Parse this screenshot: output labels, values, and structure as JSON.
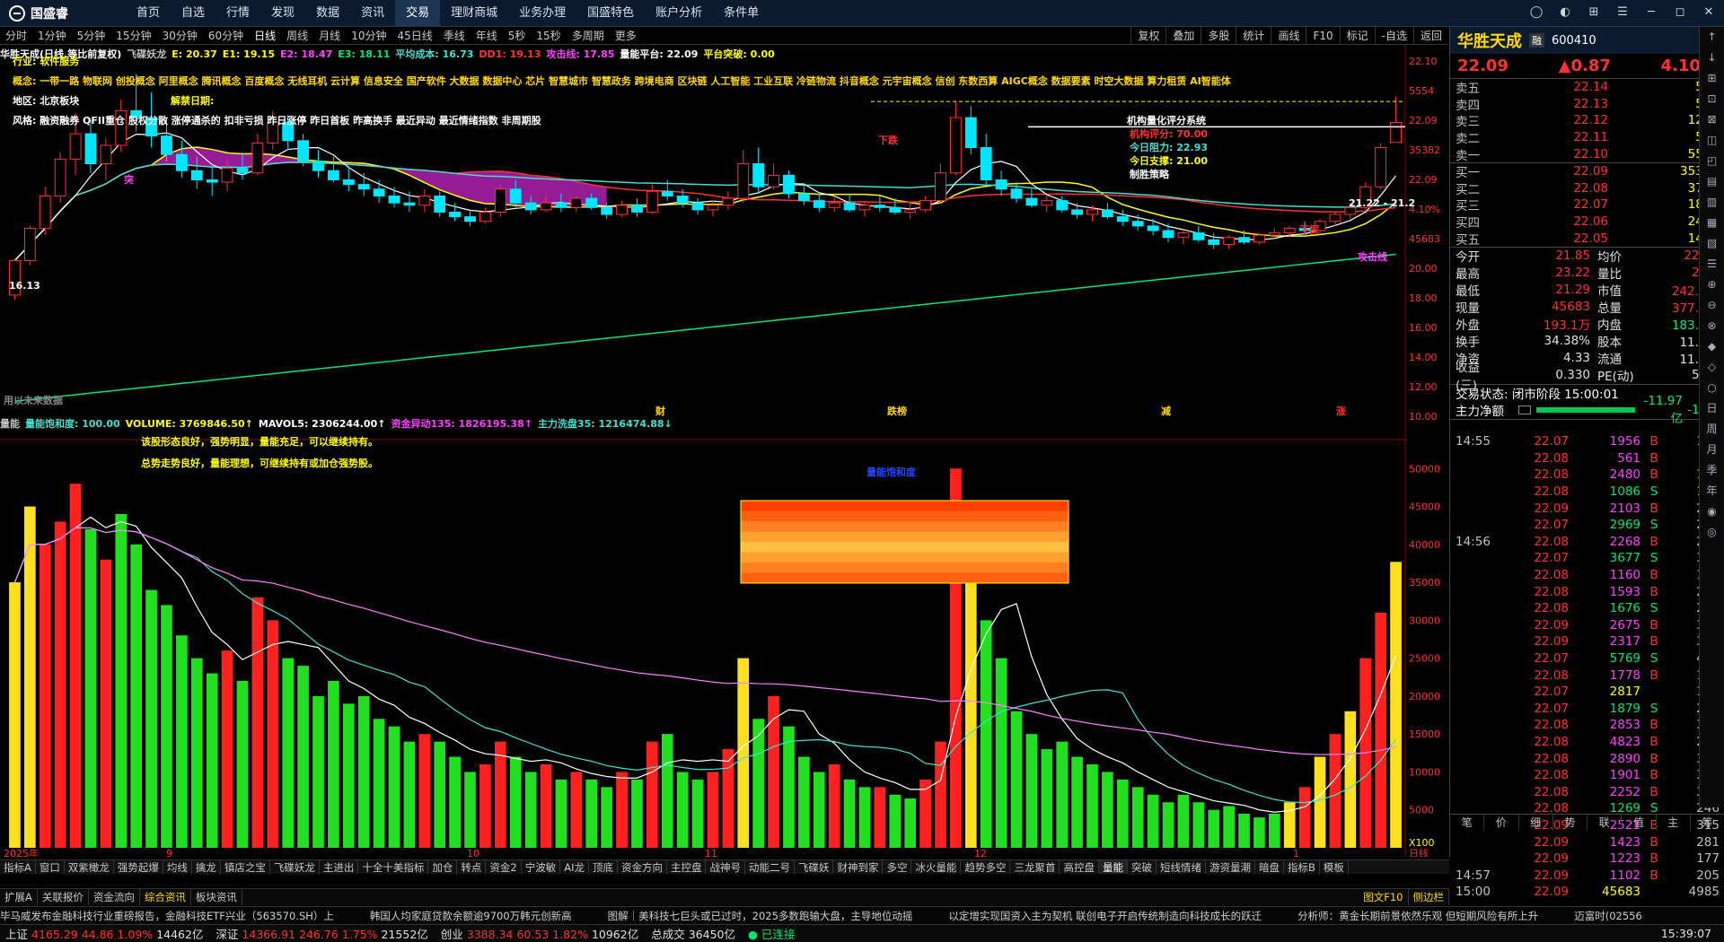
{
  "app": {
    "logo": "国盛睿"
  },
  "menu": [
    "首页",
    "自选",
    "行情",
    "发现",
    "数据",
    "资讯",
    "交易",
    "理财商城",
    "业务办理",
    "国盛特色",
    "账户分析",
    "条件单"
  ],
  "menu_active": 6,
  "periods": [
    "分时",
    "1分钟",
    "5分钟",
    "15分钟",
    "30分钟",
    "60分钟",
    "日线",
    "周线",
    "月线",
    "10分钟",
    "45日线",
    "季线",
    "年线",
    "5秒",
    "15秒",
    "多周期",
    "更多"
  ],
  "period_active": 6,
  "period_right": [
    "复权",
    "叠加",
    "多股",
    "统计",
    "画线",
    "F10",
    "标记",
    "-自选",
    "返回"
  ],
  "kline": {
    "title": "华胜天成(日线,等比前复权)",
    "legend": [
      {
        "t": "飞碟妖龙",
        "c": "#c0c0c0"
      },
      {
        "t": "E: 20.37",
        "c": "#ffff00"
      },
      {
        "t": "E1: 19.15",
        "c": "#ffff00"
      },
      {
        "t": "E2: 18.47",
        "c": "#ff40ff"
      },
      {
        "t": "E3: 18.11",
        "c": "#00e676"
      },
      {
        "t": "平均成本: 16.73",
        "c": "#40e0d0"
      },
      {
        "t": "DD1: 19.13",
        "c": "#ff3030"
      },
      {
        "t": "攻击线: 17.85",
        "c": "#ff40ff"
      },
      {
        "t": "量能平台: 22.09",
        "c": "#ffffff"
      },
      {
        "t": "平台突破: 0.00",
        "c": "#ffff00"
      }
    ],
    "industry": "行业: 软件服务",
    "concept": "概念: 一带一路 物联网 创投概念 阿里概念 腾讯概念 百度概念 无线耳机 云计算 信息安全 国产软件 大数据 数据中心 芯片 智慧城市 智慧政务 跨境电商 区块链 人工智能 工业互联 冷链物流 抖音概念 元宇宙概念 信创 东数西算 AIGC概念 数据要素 时空大数据 算力租赁 AI智能体",
    "region": "地区: 北京板块",
    "unlock": "解禁日期:",
    "style": "风格: 融资融券 QFII重仓 股权分散 涨停通杀的 扣非亏损 昨日涨停 昨日首板 昨高换手 最近异动 最近情绪指数 非周期股",
    "score_title": "机构量化评分系统",
    "score_lines": [
      "机构评分: 70.00",
      "今日阻力: 22.93",
      "今日支撑: 21.00",
      "制胜策略"
    ],
    "labels": {
      "xiadie": "下跌",
      "tuqi": "突",
      "dayuechu": "大阴戳",
      "xiaojiao": "下探",
      "gongji": "攻击线",
      "val1": "16.13",
      "val2": "21.22 - 21.2",
      "cai": "财",
      "dieting": "跌榜",
      "jian": "减",
      "zhang": "涨",
      "weilai": "用以未来数据"
    },
    "yaxis": [
      "22.10",
      "5554",
      "22.09",
      "35382",
      "22.09",
      "4.10%",
      "45683",
      "20.00",
      "18.00",
      "16.00",
      "14.00",
      "12.00",
      "10.00"
    ]
  },
  "volume": {
    "legend": [
      {
        "t": "量能",
        "c": "#c0c0c0"
      },
      {
        "t": "量能饱和度: 100.00",
        "c": "#40e0d0"
      },
      {
        "t": "VOLUME: 3769846.50↑",
        "c": "#ffff00"
      },
      {
        "t": "MAVOL5: 2306244.00↑",
        "c": "#ffffff"
      },
      {
        "t": "资金异动135: 1826195.38↑",
        "c": "#ff40ff"
      },
      {
        "t": "主力洗盘35: 1216474.88↓",
        "c": "#40e0d0"
      }
    ],
    "comments": [
      "该股形态良好，强势明显，量能充足，可以继续持有。",
      "总势走势良好，量能理想，可继续持有或加仓强势股。"
    ],
    "box_label": "量能饱和度",
    "yaxis": [
      "50000",
      "45000",
      "40000",
      "35000",
      "30000",
      "25000",
      "20000",
      "15000",
      "10000",
      "5000"
    ],
    "unit": "X100"
  },
  "dates": [
    "2025年",
    "9",
    "10",
    "11",
    "12",
    "1",
    "日线"
  ],
  "indicators": [
    "指标A",
    "窗口",
    "双紫橄龙",
    "强势起爆",
    "均线",
    "擒龙",
    "镇店之宝",
    "飞碟妖龙",
    "主进出",
    "十全十美指标",
    "加仓",
    "转点",
    "资金2",
    "宁波敏",
    "AI龙",
    "顶底",
    "资金方向",
    "主控盘",
    "战神号",
    "动能二号",
    "飞碟妖",
    "财神到家",
    "多空",
    "冰火量能",
    "趋势多空",
    "三龙聚首",
    "高控盘",
    "量能",
    "突破",
    "短线情绪",
    "游资量潮",
    "暗盘",
    "指标B",
    "模板"
  ],
  "indicator_active": 27,
  "subtabs": [
    "扩展A",
    "关联报价",
    "资金流向",
    "综合资讯",
    "板块资讯"
  ],
  "subtab_active": 3,
  "news": [
    "毕马威发布金融科技行业重磅报告，金融科技ETF兴业（563570.SH）上",
    "韩国人均家庭贷款余额逾9700万韩元创新高",
    "图解｜美科技七巨头或已过时，2025多数跑输大盘，主导地位动摇",
    "以定增实现国资入主为契机 联创电子开启传统制造向科技成长的跃迁",
    "分析师：黄金长期前景依然乐观 但短期风险有所上升",
    "迈富时(02556"
  ],
  "news_tabs": [
    "图文F10",
    "侧边栏"
  ],
  "quote": {
    "name": "华胜天成",
    "code": "600410",
    "badge": "融",
    "price": "22.09",
    "change": "▲0.87",
    "pct": "4.10%",
    "asks": [
      [
        "卖五",
        "22.14",
        "548"
      ],
      [
        "卖四",
        "22.13",
        "540"
      ],
      [
        "卖三",
        "22.12",
        "1261"
      ],
      [
        "卖二",
        "22.11",
        "564"
      ],
      [
        "卖一",
        "22.10",
        "5554"
      ]
    ],
    "bids": [
      [
        "买一",
        "22.09",
        "35382"
      ],
      [
        "买二",
        "22.08",
        "3774"
      ],
      [
        "买三",
        "22.07",
        "1822"
      ],
      [
        "买四",
        "22.06",
        "2463"
      ],
      [
        "买五",
        "22.05",
        "1493"
      ]
    ],
    "stats": [
      [
        "今开",
        "21.85",
        "均价",
        "22.13"
      ],
      [
        "最高",
        "23.22",
        "量比",
        "2.00"
      ],
      [
        "最低",
        "21.29",
        "市值",
        "242.2亿"
      ],
      [
        "现量",
        "45683",
        "总量",
        "377.0万"
      ],
      [
        "外盘",
        "193.1万",
        "内盘",
        "183.9万"
      ],
      [
        "换手",
        "34.38%",
        "股本",
        "11.0亿"
      ],
      [
        "净资",
        "4.33",
        "流通",
        "11.0亿"
      ],
      [
        "收益(三)",
        "0.330",
        "PE(动)",
        "50.7"
      ]
    ],
    "state": "交易状态: 闭市阶段 15:00:01",
    "flow_label": "主力净额",
    "flow_val": "-11.97亿",
    "flow_pct": "-14%",
    "ticks": [
      [
        "14:55",
        "22.07",
        "1956",
        "B",
        "178"
      ],
      [
        "",
        "22.08",
        "561",
        "B",
        "95"
      ],
      [
        "",
        "22.08",
        "2480",
        "B",
        "184"
      ],
      [
        "",
        "22.08",
        "1086",
        "S",
        "148"
      ],
      [
        "",
        "22.09",
        "2103",
        "B",
        "260"
      ],
      [
        "",
        "22.07",
        "2969",
        "S",
        "298"
      ],
      [
        "14:56",
        "22.08",
        "2268",
        "B",
        "233"
      ],
      [
        "",
        "22.07",
        "3677",
        "S",
        "317"
      ],
      [
        "",
        "22.08",
        "1160",
        "B",
        "190"
      ],
      [
        "",
        "22.08",
        "1593",
        "B",
        "208"
      ],
      [
        "",
        "22.08",
        "1676",
        "S",
        "252"
      ],
      [
        "",
        "22.09",
        "2675",
        "B",
        "329"
      ],
      [
        "",
        "22.09",
        "2317",
        "B",
        "306"
      ],
      [
        "",
        "22.07",
        "5769",
        "S",
        "471"
      ],
      [
        "",
        "22.08",
        "1778",
        "B",
        "185"
      ],
      [
        "",
        "22.07",
        "2817",
        "",
        "167"
      ],
      [
        "",
        "22.07",
        "1879",
        "S",
        "264"
      ],
      [
        "",
        "22.08",
        "2853",
        "B",
        "374"
      ],
      [
        "",
        "22.08",
        "4823",
        "B",
        "291"
      ],
      [
        "",
        "22.08",
        "2890",
        "B",
        "319"
      ],
      [
        "",
        "22.08",
        "1901",
        "B",
        "320"
      ],
      [
        "",
        "22.08",
        "2252",
        "B",
        "302"
      ],
      [
        "",
        "22.08",
        "1269",
        "S",
        "246"
      ],
      [
        "",
        "22.09",
        "2521",
        "B",
        "315"
      ],
      [
        "",
        "22.09",
        "1423",
        "B",
        "281"
      ],
      [
        "",
        "22.09",
        "1223",
        "B",
        "177"
      ],
      [
        "14:57",
        "22.09",
        "1102",
        "B",
        "205"
      ],
      [
        "15:00",
        "22.09",
        "45683",
        "",
        "4985"
      ]
    ],
    "tabs": [
      "笔",
      "价",
      "细",
      "势",
      "联",
      "值",
      "主",
      "筹"
    ]
  },
  "side": [
    "↑",
    "↓",
    "⊞",
    "⊡",
    "⊠",
    "◫",
    "◰",
    "▤",
    "▥",
    "▦",
    "▧",
    "☰",
    "⊕",
    "⊖",
    "⊗",
    "◆",
    "◇",
    "○",
    "日",
    "周",
    "月",
    "季",
    "年",
    "◉",
    "◎"
  ],
  "status": {
    "sh_label": "上证",
    "sh": "4165.29",
    "sh_ch": "44.86",
    "sh_pct": "1.09%",
    "sh_amt": "14462亿",
    "sz_label": "深证",
    "sz": "14366.91",
    "sz_ch": "246.76",
    "sz_pct": "1.75%",
    "sz_amt": "21552亿",
    "cy_label": "创业",
    "cy": "3388.34",
    "cy_ch": "60.53",
    "cy_pct": "1.82%",
    "cy_amt": "10962亿",
    "total_label": "总成交",
    "total": "36450亿",
    "conn": "已连接",
    "time": "15:39:07"
  },
  "chart_data": {
    "type": "candlestick",
    "candles": [
      [
        14.6,
        16.2,
        14.4,
        16.1
      ],
      [
        16.1,
        17.6,
        15.9,
        17.5
      ],
      [
        17.5,
        19.3,
        17.2,
        18.9
      ],
      [
        18.9,
        20.8,
        18.6,
        20.5
      ],
      [
        20.5,
        22.5,
        19.8,
        21.6
      ],
      [
        21.6,
        22.2,
        19.9,
        20.3
      ],
      [
        20.3,
        21.4,
        19.6,
        21.1
      ],
      [
        21.1,
        23.1,
        20.8,
        22.6
      ],
      [
        22.6,
        24.2,
        21.7,
        22.3
      ],
      [
        22.3,
        23.4,
        21.0,
        21.5
      ],
      [
        21.5,
        22.3,
        20.4,
        20.7
      ],
      [
        20.7,
        21.3,
        19.7,
        20.0
      ],
      [
        20.0,
        20.6,
        19.2,
        19.6
      ],
      [
        19.6,
        20.2,
        18.9,
        19.5
      ],
      [
        19.5,
        20.5,
        19.1,
        20.1
      ],
      [
        20.1,
        20.8,
        19.6,
        19.9
      ],
      [
        19.9,
        21.6,
        19.8,
        21.2
      ],
      [
        21.2,
        22.6,
        20.9,
        22.1
      ],
      [
        22.1,
        22.4,
        20.9,
        21.3
      ],
      [
        21.3,
        21.6,
        20.2,
        20.4
      ],
      [
        20.4,
        20.9,
        19.7,
        20.0
      ],
      [
        20.0,
        20.6,
        19.5,
        19.6
      ],
      [
        19.6,
        20.2,
        19.1,
        19.4
      ],
      [
        19.4,
        19.9,
        18.9,
        19.2
      ],
      [
        19.2,
        19.6,
        18.6,
        18.9
      ],
      [
        18.9,
        19.3,
        18.4,
        18.6
      ],
      [
        18.6,
        19.1,
        18.2,
        18.5
      ],
      [
        18.5,
        19.2,
        18.2,
        18.9
      ],
      [
        18.9,
        19.1,
        18.0,
        18.2
      ],
      [
        18.2,
        18.6,
        17.8,
        18.0
      ],
      [
        18.0,
        18.3,
        17.6,
        17.8
      ],
      [
        17.8,
        18.4,
        17.7,
        18.2
      ],
      [
        18.2,
        19.4,
        18.0,
        19.2
      ],
      [
        19.2,
        19.6,
        18.4,
        18.6
      ],
      [
        18.6,
        18.9,
        18.1,
        18.3
      ],
      [
        18.3,
        18.9,
        18.2,
        18.6
      ],
      [
        18.6,
        19.0,
        18.2,
        18.4
      ],
      [
        18.4,
        18.9,
        18.2,
        18.8
      ],
      [
        18.8,
        19.0,
        18.3,
        18.4
      ],
      [
        18.4,
        18.6,
        17.9,
        18.1
      ],
      [
        18.1,
        18.7,
        18.0,
        18.5
      ],
      [
        18.5,
        18.8,
        18.0,
        18.2
      ],
      [
        18.2,
        19.4,
        18.1,
        19.1
      ],
      [
        19.1,
        19.6,
        18.7,
        18.9
      ],
      [
        18.9,
        19.2,
        18.4,
        18.6
      ],
      [
        18.6,
        18.8,
        18.1,
        18.3
      ],
      [
        18.3,
        18.7,
        18.0,
        18.5
      ],
      [
        18.5,
        19.1,
        18.3,
        18.8
      ],
      [
        18.8,
        20.9,
        18.6,
        20.3
      ],
      [
        20.3,
        21.0,
        19.0,
        19.3
      ],
      [
        19.3,
        20.3,
        19.2,
        19.8
      ],
      [
        19.8,
        20.0,
        18.8,
        19.0
      ],
      [
        19.0,
        19.4,
        18.5,
        18.7
      ],
      [
        18.7,
        19.0,
        18.2,
        18.4
      ],
      [
        18.4,
        18.9,
        18.2,
        18.6
      ],
      [
        18.6,
        19.0,
        18.2,
        18.3
      ],
      [
        18.3,
        18.7,
        18.0,
        18.5
      ],
      [
        18.5,
        18.9,
        18.2,
        18.4
      ],
      [
        18.4,
        18.8,
        18.1,
        18.2
      ],
      [
        18.2,
        18.6,
        17.9,
        18.3
      ],
      [
        18.3,
        18.9,
        18.2,
        18.7
      ],
      [
        18.7,
        20.3,
        18.6,
        19.9
      ],
      [
        19.9,
        23.0,
        19.8,
        22.3
      ],
      [
        22.3,
        22.8,
        20.7,
        21.0
      ],
      [
        21.0,
        21.6,
        19.4,
        19.6
      ],
      [
        19.6,
        20.0,
        18.9,
        19.2
      ],
      [
        19.2,
        19.5,
        18.6,
        18.8
      ],
      [
        18.8,
        19.2,
        18.4,
        18.5
      ],
      [
        18.5,
        18.9,
        18.2,
        18.7
      ],
      [
        18.7,
        18.9,
        18.2,
        18.3
      ],
      [
        18.3,
        18.6,
        17.9,
        18.1
      ],
      [
        18.1,
        18.5,
        17.8,
        18.3
      ],
      [
        18.3,
        18.6,
        17.9,
        18.0
      ],
      [
        18.0,
        18.3,
        17.6,
        17.8
      ],
      [
        17.8,
        18.1,
        17.4,
        17.6
      ],
      [
        17.6,
        17.9,
        17.2,
        17.4
      ],
      [
        17.4,
        17.7,
        16.9,
        17.1
      ],
      [
        17.1,
        17.5,
        16.8,
        17.3
      ],
      [
        17.3,
        17.6,
        16.9,
        17.0
      ],
      [
        17.0,
        17.3,
        16.6,
        16.8
      ],
      [
        16.8,
        17.2,
        16.6,
        17.1
      ],
      [
        17.1,
        17.4,
        16.8,
        16.9
      ],
      [
        16.9,
        17.3,
        16.8,
        17.2
      ],
      [
        17.2,
        17.5,
        17.0,
        17.3
      ],
      [
        17.3,
        17.6,
        17.1,
        17.5
      ],
      [
        17.5,
        17.8,
        17.2,
        17.4
      ],
      [
        17.4,
        17.9,
        17.3,
        17.8
      ],
      [
        17.8,
        18.2,
        17.6,
        18.1
      ],
      [
        18.1,
        18.6,
        17.9,
        18.4
      ],
      [
        18.4,
        19.5,
        18.3,
        19.3
      ],
      [
        19.3,
        21.2,
        19.2,
        21.0
      ],
      [
        21.22,
        23.22,
        21.29,
        22.09
      ]
    ],
    "vols": [
      [
        35000,
        "y"
      ],
      [
        45000,
        "y"
      ],
      [
        40000,
        "r"
      ],
      [
        43000,
        "r"
      ],
      [
        48000,
        "r"
      ],
      [
        42000,
        "g"
      ],
      [
        38000,
        "r"
      ],
      [
        44000,
        "g"
      ],
      [
        40000,
        "g"
      ],
      [
        34000,
        "g"
      ],
      [
        32000,
        "g"
      ],
      [
        28000,
        "g"
      ],
      [
        25000,
        "g"
      ],
      [
        23000,
        "g"
      ],
      [
        26000,
        "r"
      ],
      [
        22000,
        "g"
      ],
      [
        33000,
        "r"
      ],
      [
        30000,
        "r"
      ],
      [
        25000,
        "g"
      ],
      [
        24000,
        "g"
      ],
      [
        20000,
        "g"
      ],
      [
        22000,
        "g"
      ],
      [
        19000,
        "g"
      ],
      [
        20000,
        "g"
      ],
      [
        17000,
        "g"
      ],
      [
        16000,
        "g"
      ],
      [
        14000,
        "g"
      ],
      [
        15000,
        "r"
      ],
      [
        14000,
        "g"
      ],
      [
        12000,
        "g"
      ],
      [
        10000,
        "g"
      ],
      [
        11000,
        "r"
      ],
      [
        14000,
        "r"
      ],
      [
        12000,
        "g"
      ],
      [
        10000,
        "g"
      ],
      [
        11000,
        "r"
      ],
      [
        9000,
        "g"
      ],
      [
        10000,
        "r"
      ],
      [
        9000,
        "g"
      ],
      [
        8000,
        "g"
      ],
      [
        10000,
        "r"
      ],
      [
        9000,
        "g"
      ],
      [
        14000,
        "r"
      ],
      [
        15000,
        "g"
      ],
      [
        10000,
        "g"
      ],
      [
        9000,
        "g"
      ],
      [
        10000,
        "r"
      ],
      [
        13000,
        "r"
      ],
      [
        25000,
        "y"
      ],
      [
        17000,
        "g"
      ],
      [
        20000,
        "r"
      ],
      [
        16000,
        "g"
      ],
      [
        12000,
        "g"
      ],
      [
        10000,
        "g"
      ],
      [
        11000,
        "r"
      ],
      [
        9000,
        "g"
      ],
      [
        8000,
        "g"
      ],
      [
        8000,
        "r"
      ],
      [
        7000,
        "g"
      ],
      [
        6500,
        "g"
      ],
      [
        9000,
        "r"
      ],
      [
        14000,
        "r"
      ],
      [
        50000,
        "r"
      ],
      [
        38000,
        "y"
      ],
      [
        30000,
        "g"
      ],
      [
        25000,
        "g"
      ],
      [
        18000,
        "g"
      ],
      [
        15000,
        "g"
      ],
      [
        13000,
        "g"
      ],
      [
        14000,
        "g"
      ],
      [
        12000,
        "g"
      ],
      [
        11000,
        "g"
      ],
      [
        10000,
        "g"
      ],
      [
        9000,
        "g"
      ],
      [
        8000,
        "g"
      ],
      [
        7000,
        "g"
      ],
      [
        6000,
        "g"
      ],
      [
        7000,
        "g"
      ],
      [
        6000,
        "g"
      ],
      [
        5000,
        "g"
      ],
      [
        5500,
        "g"
      ],
      [
        4500,
        "g"
      ],
      [
        4000,
        "g"
      ],
      [
        4500,
        "g"
      ],
      [
        6000,
        "y"
      ],
      [
        8000,
        "r"
      ],
      [
        12000,
        "y"
      ],
      [
        15000,
        "r"
      ],
      [
        18000,
        "y"
      ],
      [
        25000,
        "r"
      ],
      [
        31000,
        "r"
      ],
      [
        37700,
        "y"
      ]
    ]
  }
}
